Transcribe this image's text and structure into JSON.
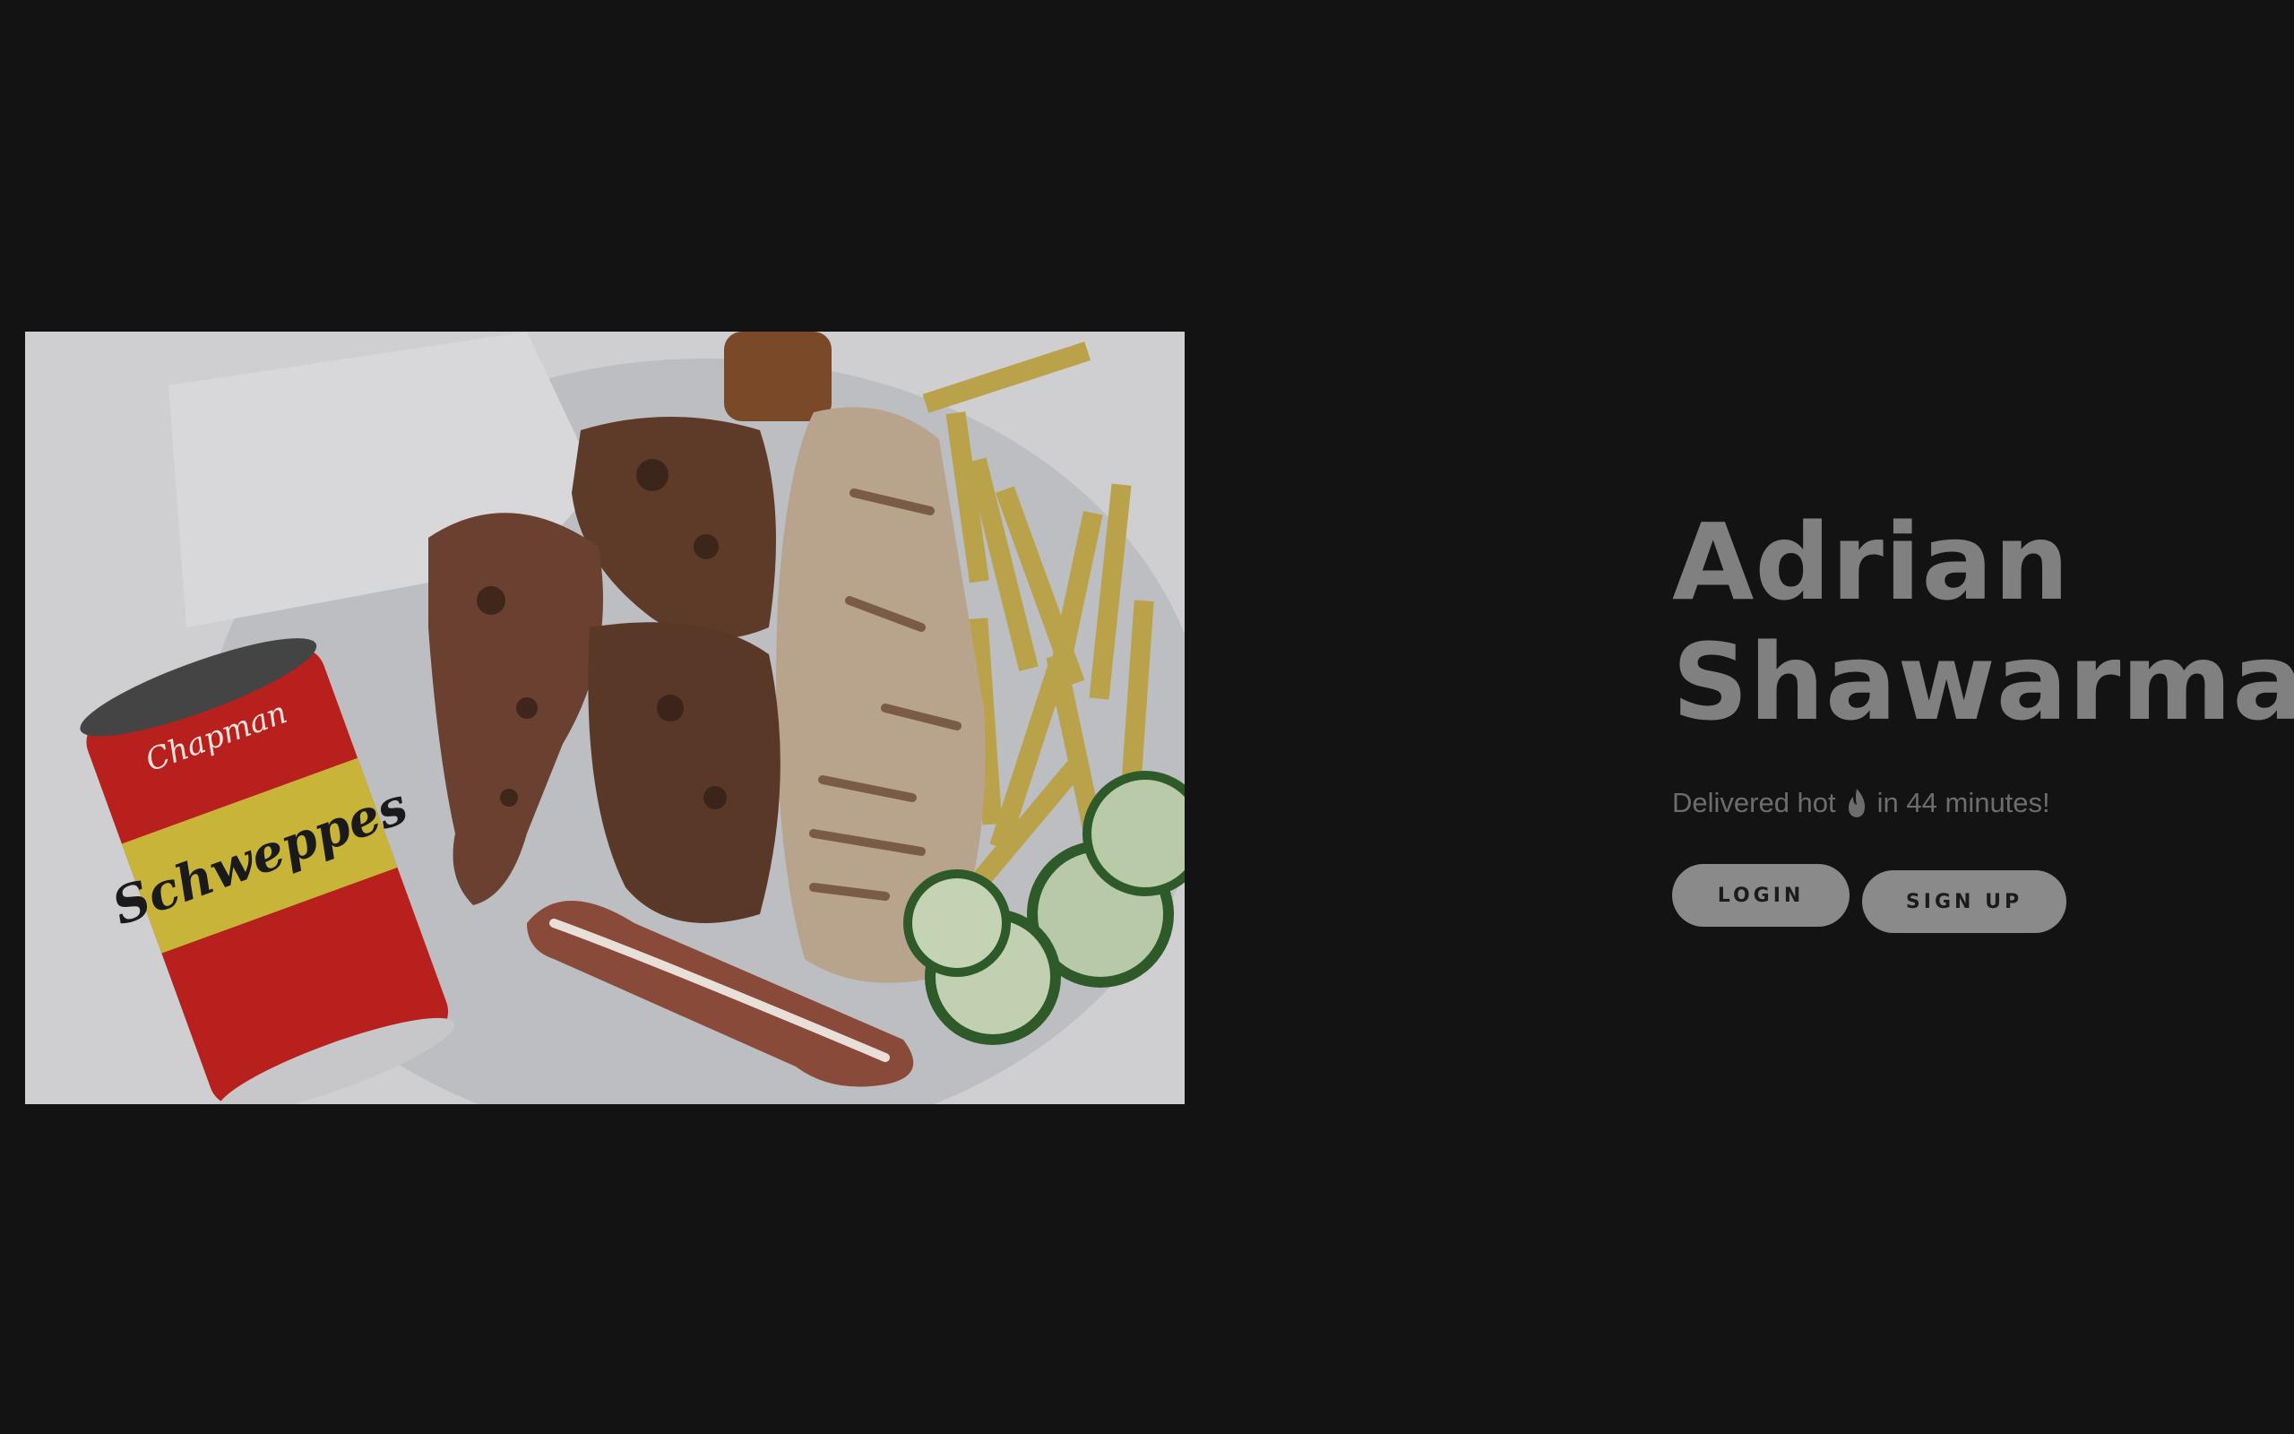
{
  "hero": {
    "image_alt": "Plate with grilled chicken, shawarma wrap, fries, sausage, cucumber slices and a can of Schweppes",
    "can_lines": [
      "Chapman",
      "Schweppes"
    ]
  },
  "brand": {
    "title_line1": "Adrian",
    "title_line2": "Shawarma.",
    "tagline_before": "Delivered hot",
    "tagline_icon": "flame-icon",
    "tagline_after": "in 44 minutes!"
  },
  "actions": {
    "login_label": "LOGIN",
    "signup_label": "SIGN UP"
  },
  "colors": {
    "background": "#131313",
    "title": "#808080",
    "button": "#8a8a8a"
  }
}
